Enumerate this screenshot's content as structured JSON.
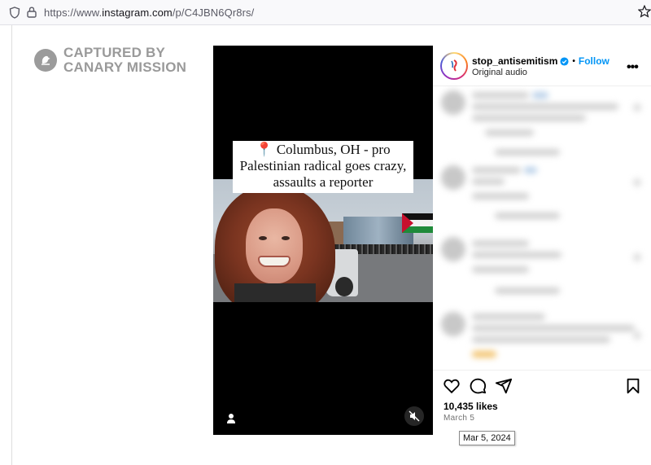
{
  "browser": {
    "url_prefix": "https://www.",
    "url_host": "instagram.com",
    "url_path": "/p/C4JBN6Qr8rs/"
  },
  "watermark": {
    "line1": "CAPTURED BY",
    "line2": "CANARY MISSION"
  },
  "video": {
    "caption_pin": "📍",
    "caption_text": "Columbus, OH - pro Palestinian radical goes crazy, assaults a reporter",
    "muted": true
  },
  "post": {
    "username": "stop_antisemitism",
    "verified": true,
    "separator": "•",
    "follow_label": "Follow",
    "audio": "Original audio",
    "more_label": "•••",
    "likes": "10,435 likes",
    "date": "March 5",
    "date_tooltip": "Mar 5, 2024"
  },
  "colors": {
    "follow": "#0095f6",
    "verified": "#0095f6",
    "pin": "#d92b2b"
  },
  "icons": [
    "shield-icon",
    "lock-icon",
    "star-icon",
    "heart-icon",
    "comment-icon",
    "share-icon",
    "bookmark-icon",
    "user-tag-icon",
    "muted-speaker-icon",
    "verified-badge-icon",
    "more-options-icon"
  ]
}
